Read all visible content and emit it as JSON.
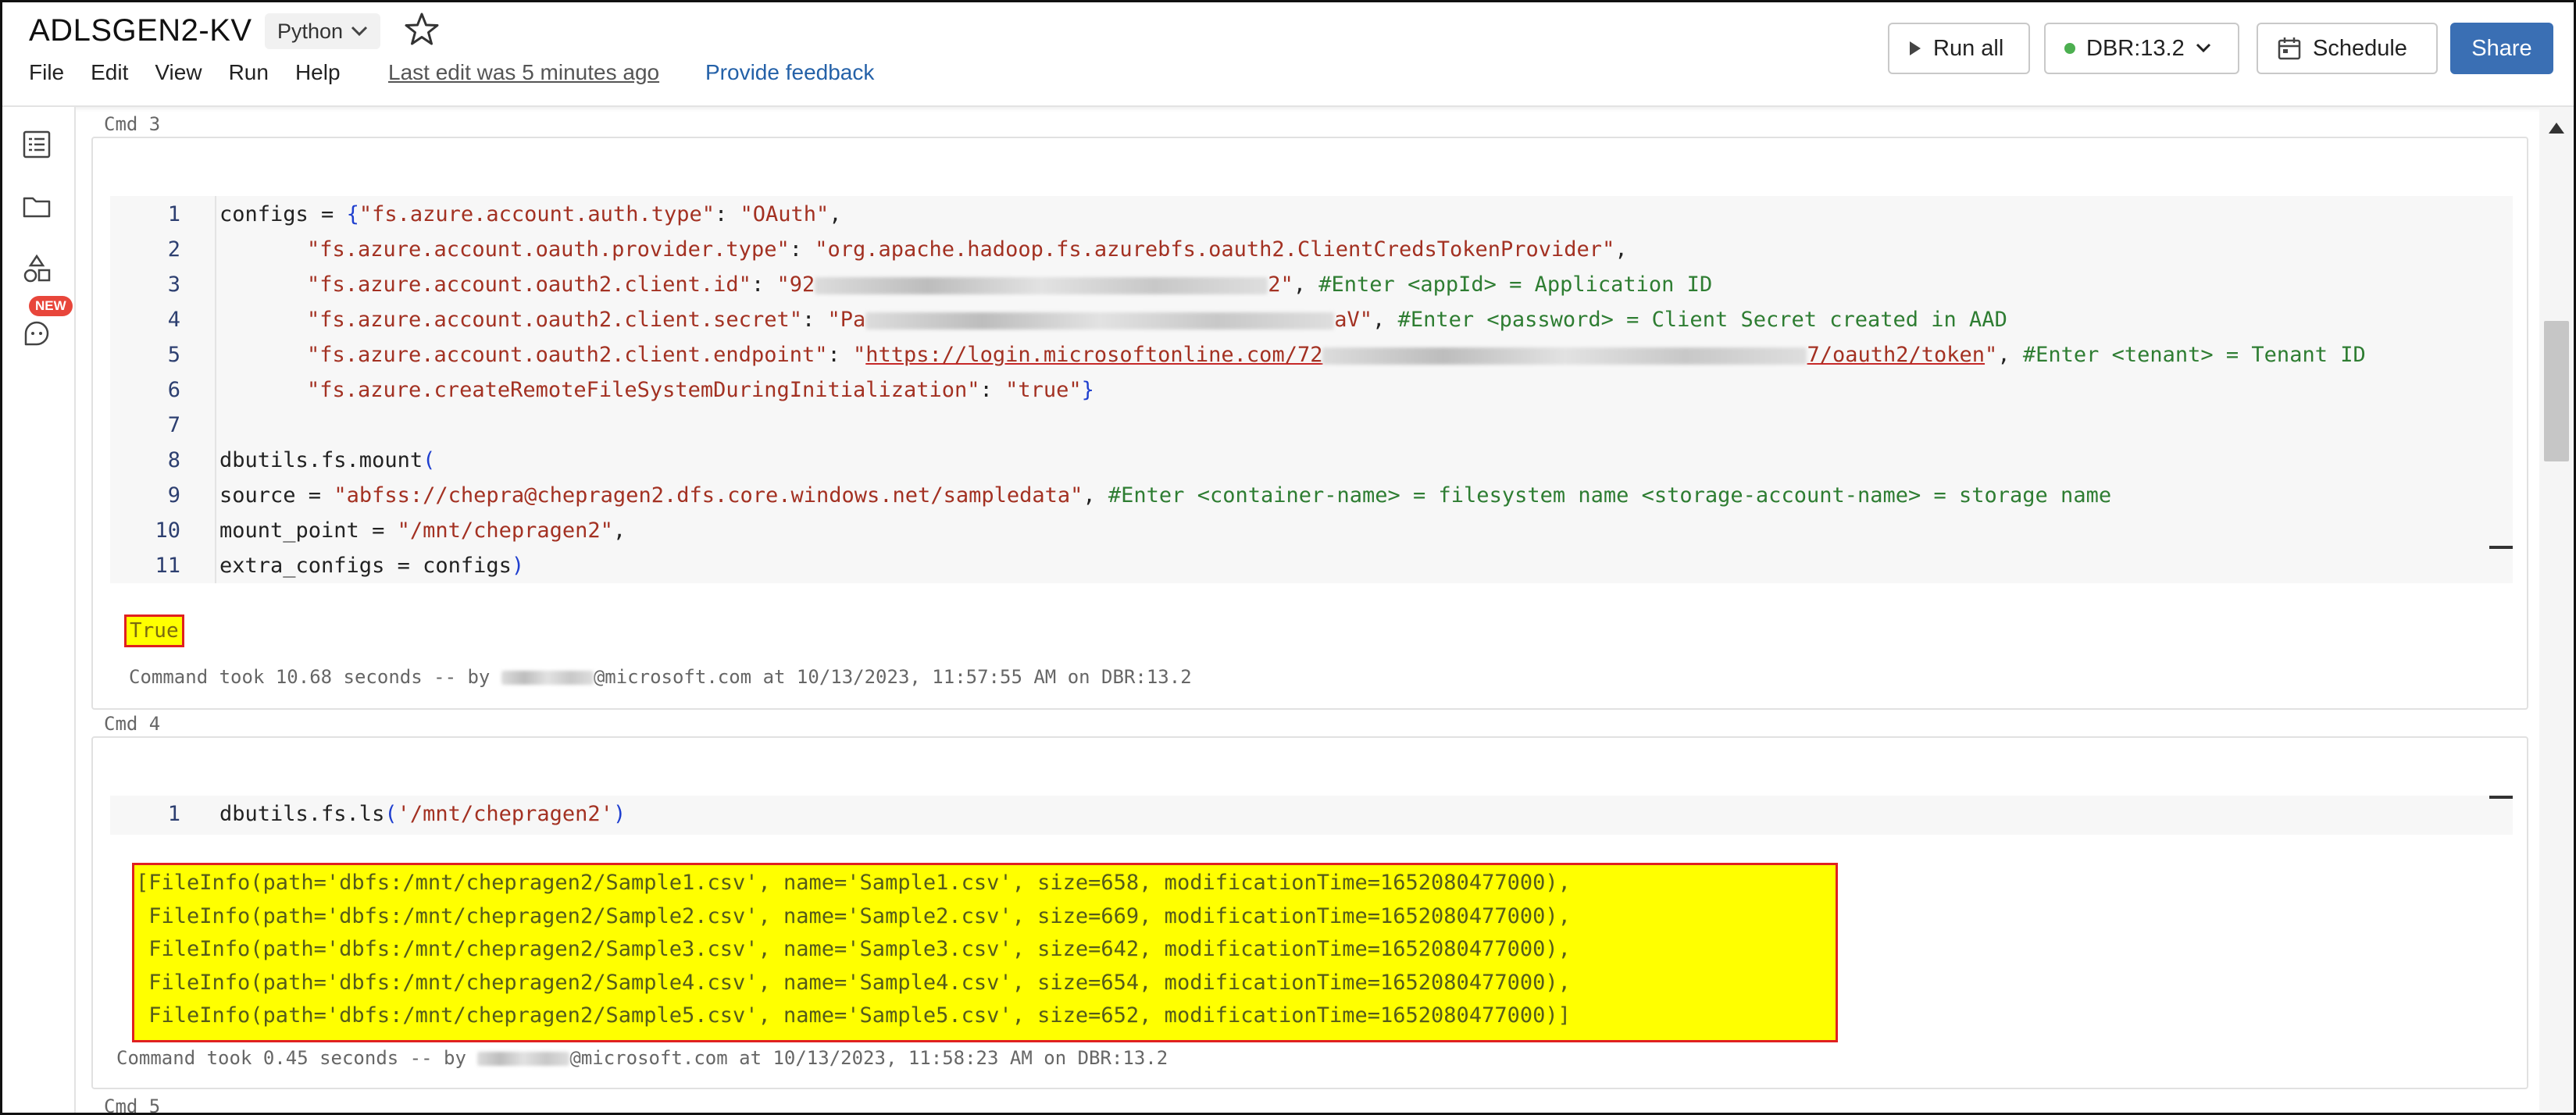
{
  "header": {
    "title": "ADLSGEN2-KV",
    "language": "Python",
    "menu": [
      "File",
      "Edit",
      "View",
      "Run",
      "Help"
    ],
    "last_edit": "Last edit was 5 minutes ago",
    "feedback": "Provide feedback",
    "run_all": "Run all",
    "cluster": "DBR:13.2",
    "schedule": "Schedule",
    "share": "Share"
  },
  "sidebar": {
    "new_badge": "NEW"
  },
  "cells": {
    "cmd3": {
      "label": "Cmd 3",
      "line_numbers": [
        "1",
        "2",
        "3",
        "4",
        "5",
        "6",
        "7",
        "8",
        "9",
        "10",
        "11"
      ],
      "l1_a": "configs = ",
      "l1_b": "{",
      "l1_c": "\"fs.azure.account.auth.type\"",
      "l1_d": ": ",
      "l1_e": "\"OAuth\"",
      "l1_f": ",",
      "l2_a": "\"fs.azure.account.oauth.provider.type\"",
      "l2_b": ": ",
      "l2_c": "\"org.apache.hadoop.fs.azurebfs.oauth2.ClientCredsTokenProvider\"",
      "l2_d": ",",
      "l3_a": "\"fs.azure.account.oauth2.client.id\"",
      "l3_b": ": ",
      "l3_c": "\"92",
      "l3_d": "2\"",
      "l3_e": ", ",
      "l3_f": "#Enter <appId> = Application ID",
      "l4_a": "\"fs.azure.account.oauth2.client.secret\"",
      "l4_b": ": ",
      "l4_c": "\"Pa",
      "l4_d": "aV\"",
      "l4_e": ", ",
      "l4_f": "#Enter <password> = Client Secret created in AAD",
      "l5_a": "\"fs.azure.account.oauth2.client.endpoint\"",
      "l5_b": ": ",
      "l5_c": "\"",
      "l5_d": "https://login.microsoftonline.com/72",
      "l5_e": "7/oauth2/token",
      "l5_f": "\"",
      "l5_g": ", ",
      "l5_h": "#Enter <tenant> = Tenant ID",
      "l6_a": "\"fs.azure.createRemoteFileSystemDuringInitialization\"",
      "l6_b": ": ",
      "l6_c": "\"true\"",
      "l6_d": "}",
      "l8_a": "dbutils.fs.mount",
      "l8_b": "(",
      "l9_a": "source = ",
      "l9_b": "\"abfss://chepra@chepragen2.dfs.core.windows.net/sampledata\"",
      "l9_c": ", ",
      "l9_d": "#Enter <container-name> = filesystem name <storage-account-name> = storage name",
      "l10_a": "mount_point = ",
      "l10_b": "\"/mnt/chepragen2\"",
      "l10_c": ",",
      "l11_a": "extra_configs = configs",
      "l11_b": ")",
      "output": "True",
      "took_a": "Command took 10.68 seconds -- by ",
      "took_b": "@microsoft.com at 10/13/2023, 11:57:55 AM on DBR:13.2"
    },
    "cmd4": {
      "label": "Cmd 4",
      "line_number": "1",
      "code_a": "dbutils.fs.ls",
      "code_b": "(",
      "code_c": "'/mnt/chepragen2'",
      "code_d": ")",
      "output_rows": [
        "[FileInfo(path='dbfs:/mnt/chepragen2/Sample1.csv', name='Sample1.csv', size=658, modificationTime=1652080477000),",
        " FileInfo(path='dbfs:/mnt/chepragen2/Sample2.csv', name='Sample2.csv', size=669, modificationTime=1652080477000),",
        " FileInfo(path='dbfs:/mnt/chepragen2/Sample3.csv', name='Sample3.csv', size=642, modificationTime=1652080477000),",
        " FileInfo(path='dbfs:/mnt/chepragen2/Sample4.csv', name='Sample4.csv', size=654, modificationTime=1652080477000),",
        " FileInfo(path='dbfs:/mnt/chepragen2/Sample5.csv', name='Sample5.csv', size=652, modificationTime=1652080477000)]"
      ],
      "took_a": "Command took 0.45 seconds -- by ",
      "took_b": "@microsoft.com at 10/13/2023, 11:58:23 AM on DBR:13.2"
    },
    "cmd5": {
      "label": "Cmd 5"
    }
  },
  "colors": {
    "share_bg": "#3a6fb4",
    "highlight": "#ffff00",
    "highlight_border": "#e02020",
    "string": "#a33122",
    "comment": "#2e7d32"
  },
  "icons": [
    "star-icon",
    "play-icon",
    "chevron-down-icon",
    "calendar-icon",
    "toc-icon",
    "folder-icon",
    "shapes-icon",
    "assistant-icon"
  ]
}
